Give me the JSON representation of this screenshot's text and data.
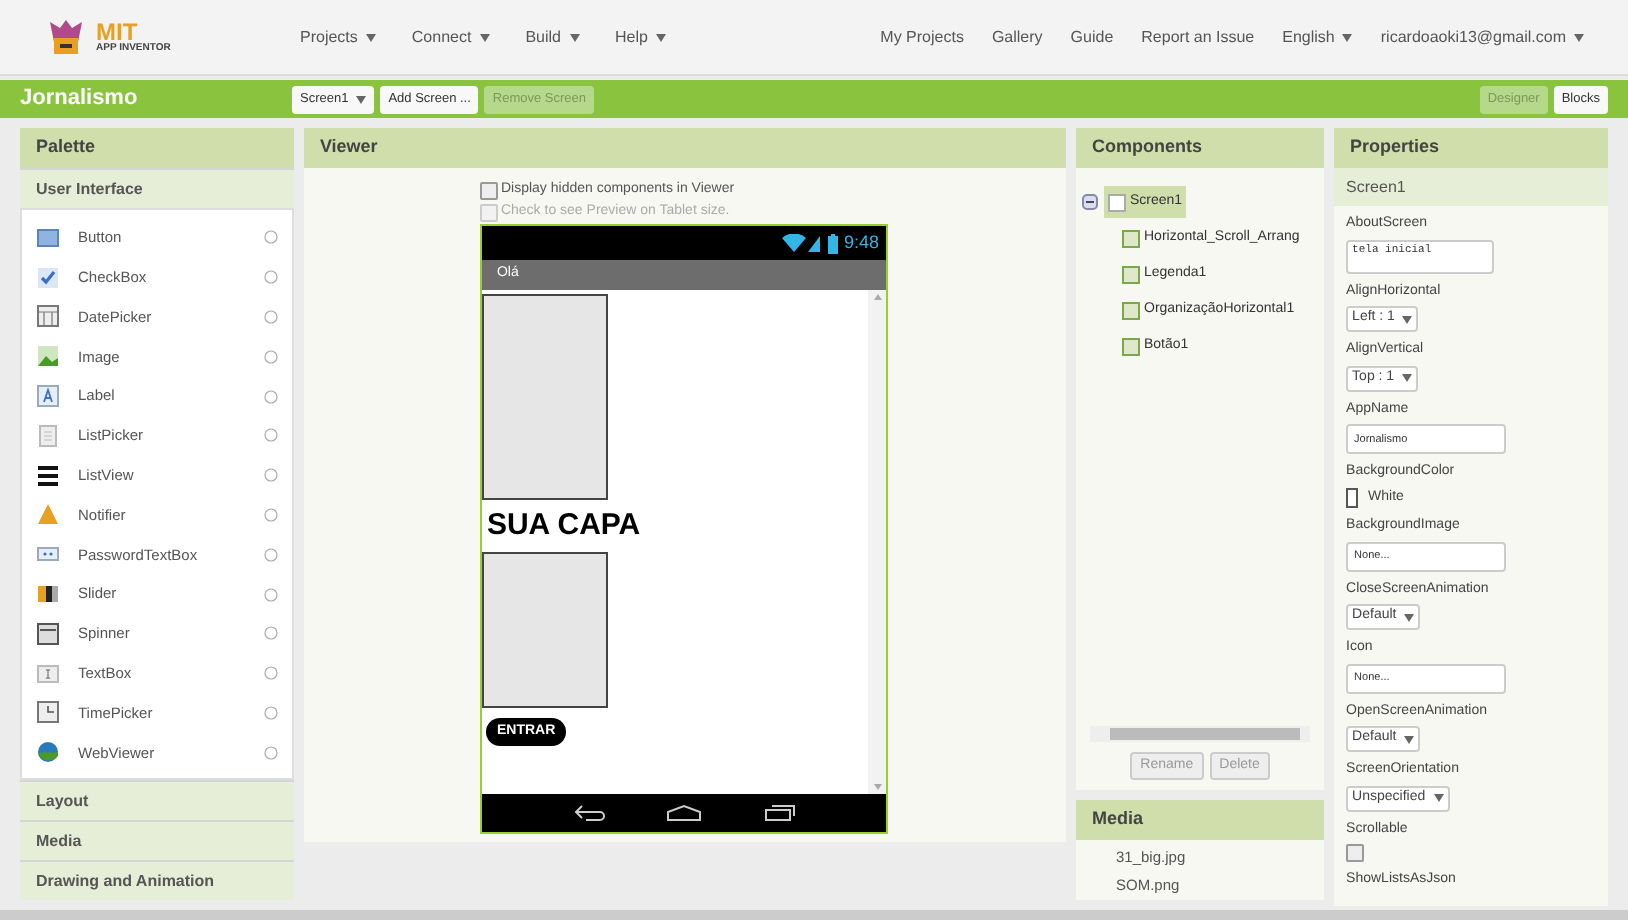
{
  "menu": {
    "logo_top": "MIT",
    "logo_bottom": "APP INVENTOR",
    "left": [
      {
        "label": "Projects",
        "dropdown": true
      },
      {
        "label": "Connect",
        "dropdown": true
      },
      {
        "label": "Build",
        "dropdown": true
      },
      {
        "label": "Help",
        "dropdown": true
      }
    ],
    "right": [
      {
        "label": "My Projects",
        "dropdown": false
      },
      {
        "label": "Gallery",
        "dropdown": false
      },
      {
        "label": "Guide",
        "dropdown": false
      },
      {
        "label": "Report an Issue",
        "dropdown": false
      },
      {
        "label": "English",
        "dropdown": true
      },
      {
        "label": "ricardoaoki13@gmail.com",
        "dropdown": true
      }
    ]
  },
  "project_bar": {
    "title": "Jornalismo",
    "buttons": [
      {
        "label": "Screen1",
        "dropdown": true,
        "disabled": false
      },
      {
        "label": "Add Screen ...",
        "dropdown": false,
        "disabled": false
      },
      {
        "label": "Remove Screen",
        "dropdown": false,
        "disabled": true
      }
    ],
    "views": [
      {
        "label": "Designer",
        "selected": true
      },
      {
        "label": "Blocks",
        "selected": false
      }
    ]
  },
  "palette": {
    "title": "Palette",
    "sections": [
      {
        "label": "User Interface",
        "expanded": true,
        "items": [
          "Button",
          "CheckBox",
          "DatePicker",
          "Image",
          "Label",
          "ListPicker",
          "ListView",
          "Notifier",
          "PasswordTextBox",
          "Slider",
          "Spinner",
          "TextBox",
          "TimePicker",
          "WebViewer"
        ]
      },
      {
        "label": "Layout",
        "expanded": false
      },
      {
        "label": "Media",
        "expanded": false
      },
      {
        "label": "Drawing and Animation",
        "expanded": false
      }
    ]
  },
  "viewer": {
    "title": "Viewer",
    "options": [
      {
        "label": "Display hidden components in Viewer",
        "checked": false,
        "disabled": false
      },
      {
        "label": "Check to see Preview on Tablet size.",
        "checked": false,
        "disabled": true
      }
    ],
    "phone": {
      "time": "9:48",
      "title": "Olá",
      "components": [
        {
          "kind": "box"
        },
        {
          "kind": "label",
          "text": "SUA CAPA"
        },
        {
          "kind": "box"
        },
        {
          "kind": "button",
          "text": "ENTRAR"
        }
      ]
    }
  },
  "components": {
    "title": "Components",
    "tree": [
      {
        "label": "Screen1",
        "selected": true,
        "expanded": true,
        "children": [
          {
            "label": "Horizontal_Scroll_Arrang",
            "selected": false
          },
          {
            "label": "Legenda1",
            "selected": false
          },
          {
            "label": "OrganizaçãoHorizontal1",
            "selected": false
          },
          {
            "label": "Botão1",
            "selected": false
          }
        ]
      }
    ],
    "buttons": [
      {
        "label": "Rename",
        "disabled": true
      },
      {
        "label": "Delete",
        "disabled": true
      }
    ]
  },
  "media": {
    "title": "Media",
    "files": [
      "31_big.jpg",
      "SOM.png"
    ]
  },
  "properties": {
    "title": "Properties",
    "component": "Screen1",
    "items": [
      {
        "kind": "textarea",
        "name": "AboutScreen",
        "value": "tela inicial"
      },
      {
        "kind": "select",
        "name": "AlignHorizontal",
        "value": "Left : 1"
      },
      {
        "kind": "select",
        "name": "AlignVertical",
        "value": "Top : 1"
      },
      {
        "kind": "text",
        "name": "AppName",
        "value": "Jornalismo"
      },
      {
        "kind": "color",
        "name": "BackgroundColor",
        "value": "White",
        "color": "#ffffff"
      },
      {
        "kind": "text",
        "name": "BackgroundImage",
        "value": "None..."
      },
      {
        "kind": "select",
        "name": "CloseScreenAnimation",
        "value": "Default"
      },
      {
        "kind": "text",
        "name": "Icon",
        "value": "None..."
      },
      {
        "kind": "select",
        "name": "OpenScreenAnimation",
        "value": "Default"
      },
      {
        "kind": "select",
        "name": "ScreenOrientation",
        "value": "Unspecified"
      },
      {
        "kind": "checkbox",
        "name": "Scrollable",
        "checked": false
      },
      {
        "kind": "label",
        "name": "ShowListsAsJson"
      }
    ]
  }
}
